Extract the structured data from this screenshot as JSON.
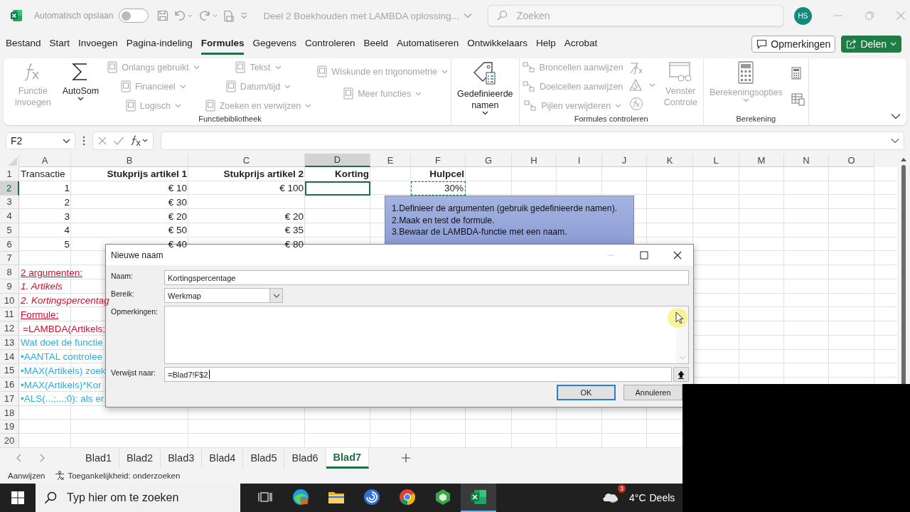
{
  "title_bar": {
    "autosave_label": "Automatisch opslaan",
    "autosave_on": false,
    "document_title": "Deel 2 Boekhouden met LAMBDA oplossing...",
    "search_placeholder": "Zoeken",
    "avatar": "HS"
  },
  "menu_tabs": [
    {
      "label": "Bestand",
      "selected": false
    },
    {
      "label": "Start",
      "selected": false
    },
    {
      "label": "Invoegen",
      "selected": false
    },
    {
      "label": "Pagina-indeling",
      "selected": false
    },
    {
      "label": "Formules",
      "selected": true
    },
    {
      "label": "Gegevens",
      "selected": false
    },
    {
      "label": "Controleren",
      "selected": false
    },
    {
      "label": "Beeld",
      "selected": false
    },
    {
      "label": "Automatiseren",
      "selected": false
    },
    {
      "label": "Ontwikkelaars",
      "selected": false
    },
    {
      "label": "Help",
      "selected": false
    },
    {
      "label": "Acrobat",
      "selected": false
    }
  ],
  "comments_button": "Opmerkingen",
  "share_button": "Delen",
  "ribbon_groups": [
    {
      "label": "Functiebibliotheek",
      "columns": [
        [
          {
            "kind": "large",
            "label": "Functie invoegen",
            "disabled": true,
            "has_dropdown": false
          }
        ],
        [
          {
            "kind": "large",
            "label": "AutoSom",
            "disabled": false,
            "has_dropdown": true
          }
        ],
        [
          {
            "kind": "small",
            "label": "Onlangs gebruikt",
            "disabled": true,
            "has_dropdown": true
          },
          {
            "kind": "small",
            "label": "Financieel",
            "disabled": true,
            "has_dropdown": true
          },
          {
            "kind": "small",
            "label": "Logisch",
            "disabled": true,
            "has_dropdown": true
          }
        ],
        [
          {
            "kind": "small",
            "label": "Tekst",
            "disabled": true,
            "has_dropdown": true
          },
          {
            "kind": "small",
            "label": "Datum/tijd",
            "disabled": true,
            "has_dropdown": true
          },
          {
            "kind": "small",
            "label": "Zoeken en verwijzen",
            "disabled": true,
            "has_dropdown": true
          }
        ],
        [
          {
            "kind": "small",
            "label": "Wiskunde en trigonometrie",
            "disabled": true,
            "has_dropdown": true
          },
          {
            "kind": "small",
            "label": "Meer functies",
            "disabled": true,
            "has_dropdown": true
          }
        ]
      ]
    },
    {
      "columns": [
        [
          {
            "kind": "large",
            "label": "Gedefinieerde namen",
            "disabled": false,
            "has_dropdown": true
          }
        ]
      ]
    },
    {
      "label": "Formules controleren",
      "columns": [
        [
          {
            "kind": "small",
            "label": "Broncellen aanwijzen",
            "disabled": true,
            "has_dropdown": false
          },
          {
            "kind": "small",
            "label": "Doelcellen aanwijzen",
            "disabled": true,
            "has_dropdown": false
          },
          {
            "kind": "small",
            "label": "Pijlen verwijderen",
            "disabled": true,
            "has_dropdown": true
          }
        ],
        [
          {
            "kind": "icon",
            "disabled": true,
            "has_dropdown": false
          },
          {
            "kind": "icon",
            "disabled": true,
            "has_dropdown": true
          },
          {
            "kind": "icon",
            "disabled": true,
            "has_dropdown": false
          }
        ],
        [
          {
            "kind": "large",
            "label": "Venster Controle",
            "disabled": true,
            "has_dropdown": false
          }
        ]
      ]
    },
    {
      "label": "Berekening",
      "columns": [
        [
          {
            "kind": "large",
            "label": "Berekeningsopties",
            "disabled": true,
            "has_dropdown": true
          }
        ],
        [
          {
            "kind": "icon",
            "disabled": false,
            "has_dropdown": false
          },
          {
            "kind": "icon",
            "disabled": false,
            "has_dropdown": false
          }
        ]
      ]
    }
  ],
  "formula_bar": {
    "name_box": "F2"
  },
  "grid": {
    "columns": [
      {
        "label": "A",
        "selected": false
      },
      {
        "label": "B",
        "selected": false
      },
      {
        "label": "C",
        "selected": false
      },
      {
        "label": "D",
        "selected": true
      },
      {
        "label": "E",
        "selected": false
      },
      {
        "label": "F",
        "selected": false
      },
      {
        "label": "G",
        "selected": false
      },
      {
        "label": "H",
        "selected": false
      },
      {
        "label": "I",
        "selected": false
      },
      {
        "label": "J",
        "selected": false
      },
      {
        "label": "K",
        "selected": false
      },
      {
        "label": "L",
        "selected": false
      },
      {
        "label": "M",
        "selected": false
      },
      {
        "label": "N",
        "selected": false
      },
      {
        "label": "O",
        "selected": false
      }
    ],
    "rows": [
      {
        "number": "1",
        "selected": false,
        "cells": [
          {
            "text": "Transactie",
            "kind": "text"
          },
          {
            "text": "Stukprijs artikel 1",
            "kind": "header"
          },
          {
            "text": "Stukprijs artikel 2",
            "kind": "header"
          },
          {
            "text": "Korting",
            "kind": "header"
          },
          null,
          {
            "text": "Hulpcel",
            "kind": "header"
          }
        ]
      },
      {
        "number": "2",
        "selected": true,
        "cells": [
          {
            "text": "1",
            "kind": "number"
          },
          {
            "text": "€ 10",
            "kind": "number"
          },
          {
            "text": "€ 100",
            "kind": "number"
          },
          null,
          null,
          {
            "text": "30%",
            "kind": "marquee"
          }
        ]
      },
      {
        "number": "3",
        "selected": false,
        "cells": [
          {
            "text": "2",
            "kind": "number"
          },
          {
            "text": "€ 30",
            "kind": "number"
          }
        ]
      },
      {
        "number": "4",
        "selected": false,
        "cells": [
          {
            "text": "3",
            "kind": "number"
          },
          {
            "text": "€ 20",
            "kind": "number"
          },
          {
            "text": "€ 20",
            "kind": "number"
          }
        ]
      },
      {
        "number": "5",
        "selected": false,
        "cells": [
          {
            "text": "4",
            "kind": "number"
          },
          {
            "text": "€ 50",
            "kind": "number"
          },
          {
            "text": "€ 35",
            "kind": "number"
          }
        ]
      },
      {
        "number": "6",
        "selected": false,
        "cells": [
          {
            "text": "5",
            "kind": "number"
          },
          {
            "text": "€ 40",
            "kind": "number"
          },
          {
            "text": "€ 80",
            "kind": "number"
          }
        ]
      },
      {
        "number": "7",
        "selected": false
      },
      {
        "number": "8",
        "selected": false,
        "cells": [
          {
            "text": "2 argumenten:",
            "kind": "red-underline"
          }
        ]
      },
      {
        "number": "9",
        "selected": false,
        "cells": [
          {
            "text": "1. Artikels",
            "kind": "red-italic"
          }
        ]
      },
      {
        "number": "10",
        "selected": false,
        "cells": [
          {
            "text": "2. Kortingspercentag",
            "kind": "red-italic"
          }
        ]
      },
      {
        "number": "11",
        "selected": false,
        "cells": [
          {
            "text": "Formule:",
            "kind": "red-underline"
          }
        ]
      },
      {
        "number": "12",
        "selected": false,
        "cells": [
          {
            "text": "=LAMBDA(Artikels;",
            "kind": "red"
          }
        ]
      },
      {
        "number": "13",
        "selected": false,
        "cells": [
          {
            "text": "Wat doet de functie",
            "kind": "cyan"
          }
        ]
      },
      {
        "number": "14",
        "selected": false,
        "cells": [
          {
            "text": "•AANTAL controlee",
            "kind": "cyan"
          }
        ]
      },
      {
        "number": "15",
        "selected": false,
        "cells": [
          {
            "text": "•MAX(Artikels) zoek",
            "kind": "cyan"
          }
        ]
      },
      {
        "number": "16",
        "selected": false,
        "cells": [
          {
            "text": "•MAX(Artikels)*Kor",
            "kind": "cyan"
          }
        ]
      },
      {
        "number": "17",
        "selected": false,
        "cells": [
          {
            "text": "•ALS(...;...;0): als er",
            "kind": "cyan"
          }
        ]
      },
      {
        "number": "18",
        "selected": false
      },
      {
        "number": "19",
        "selected": false
      },
      {
        "number": "20",
        "selected": false
      }
    ]
  },
  "note_shape": {
    "lines": [
      "1.Definieer de argumenten (gebruik gedefinieerde namen).",
      "2.Maak en test de formule.",
      "3.Bewaar de LAMBDA-functie met een naam."
    ]
  },
  "dialog": {
    "title": "Nieuwe naam",
    "fields": [
      {
        "label": "Naam:",
        "kind": "text",
        "value": "Kortingspercentage"
      },
      {
        "label": "Bereik:",
        "kind": "dropdown",
        "value": "Werkmap"
      },
      {
        "label": "Opmerkingen:",
        "kind": "textarea"
      },
      {
        "label": "Verwijst naar:",
        "kind": "reference",
        "value": "=Blad7!F$2"
      }
    ],
    "buttons": [
      {
        "label": "OK",
        "default": true
      },
      {
        "label": "Annuleren",
        "default": false
      }
    ]
  },
  "sheet_tabs": [
    {
      "label": "Blad1",
      "selected": false
    },
    {
      "label": "Blad2",
      "selected": false
    },
    {
      "label": "Blad3",
      "selected": false
    },
    {
      "label": "Blad4",
      "selected": false
    },
    {
      "label": "Blad5",
      "selected": false
    },
    {
      "label": "Blad6",
      "selected": false
    },
    {
      "label": "Blad7",
      "selected": true
    }
  ],
  "status_bar": {
    "mode": "Aanwijzen",
    "accessibility": "Toegankelijkheid: onderzoeken"
  },
  "taskbar": {
    "search_placeholder": "Typ hier om te zoeken",
    "apps": [
      {
        "selected": false
      },
      {
        "selected": false
      },
      {
        "selected": false
      },
      {
        "selected": false
      },
      {
        "selected": false
      },
      {
        "selected": false
      },
      {
        "selected": true
      }
    ],
    "weather_badge": "3",
    "temperature": "4°C",
    "weather_text": "Deels"
  }
}
